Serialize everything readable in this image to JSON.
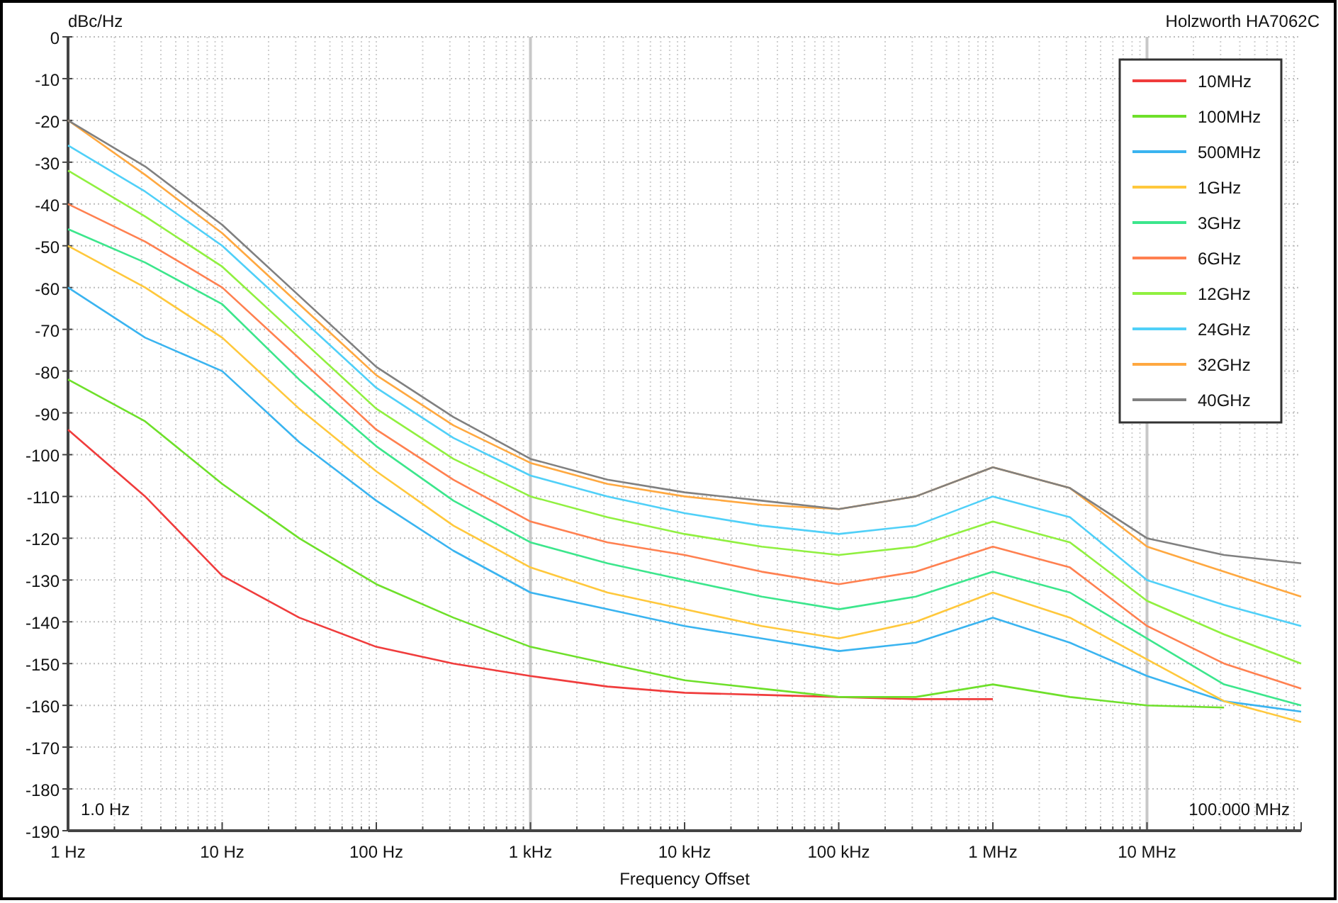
{
  "chart_data": {
    "type": "line",
    "title": "Holzworth HA7062C",
    "xlabel": "Frequency Offset",
    "ylabel": "dBc/Hz",
    "categories": [
      "1 Hz",
      null,
      "10 Hz",
      null,
      "100 Hz",
      null,
      "1 kHz",
      null,
      "10 kHz",
      null,
      "100 kHz",
      null,
      "1 MHz",
      null,
      "10 MHz",
      null,
      null
    ],
    "ylim": [
      -190,
      0
    ],
    "grid": true,
    "legend": true,
    "yticks": [
      0,
      -10,
      -20,
      -30,
      -40,
      -50,
      -60,
      -70,
      -80,
      -90,
      -100,
      -110,
      -120,
      -130,
      -140,
      -150,
      -160,
      -170,
      -180,
      -190
    ],
    "series": [
      {
        "name": "10MHz",
        "color": "#f03c3c",
        "values": [
          -94,
          -110,
          -129,
          -139,
          -146,
          -150,
          -153,
          -155.5,
          -157,
          -157.5,
          -158,
          -158.5,
          -158.5,
          null,
          null,
          null,
          null
        ]
      },
      {
        "name": "100MHz",
        "color": "#6ee02a",
        "values": [
          -82,
          -92,
          -107,
          -120,
          -131,
          -139,
          -146,
          -150,
          -154,
          -156,
          -158,
          -158,
          -155,
          -158,
          -160,
          -160.5,
          null
        ]
      },
      {
        "name": "500MHz",
        "color": "#3ab4f0",
        "values": [
          -60,
          -72,
          -80,
          -97,
          -111,
          -123,
          -133,
          -137,
          -141,
          -144,
          -147,
          -145,
          -139,
          -145,
          -153,
          -159,
          -161.5
        ]
      },
      {
        "name": "1GHz",
        "color": "#ffc83c",
        "values": [
          -50,
          -60,
          -72,
          -89,
          -104,
          -117,
          -127,
          -133,
          -137,
          -141,
          -144,
          -140,
          -133,
          -139,
          -149,
          -159,
          -164
        ]
      },
      {
        "name": "3GHz",
        "color": "#3ce68c",
        "values": [
          -46,
          -54,
          -64,
          -82,
          -98,
          -111,
          -121,
          -126,
          -130,
          -134,
          -137,
          -134,
          -128,
          -133,
          -144,
          -155,
          -160
        ]
      },
      {
        "name": "6GHz",
        "color": "#ff8050",
        "values": [
          -40,
          -49,
          -60,
          -77,
          -94,
          -106,
          -116,
          -121,
          -124,
          -128,
          -131,
          -128,
          -122,
          -127,
          -141,
          -150,
          -156
        ]
      },
      {
        "name": "12GHz",
        "color": "#90f040",
        "values": [
          -32,
          -43,
          -55,
          -72,
          -89,
          -101,
          -110,
          -115,
          -119,
          -122,
          -124,
          -122,
          -116,
          -121,
          -135,
          -143,
          -150
        ]
      },
      {
        "name": "24GHz",
        "color": "#50d0f8",
        "values": [
          -26,
          -37,
          -50,
          -67,
          -84,
          -96,
          -105,
          -110,
          -114,
          -117,
          -119,
          -117,
          -110,
          -115,
          -130,
          -136,
          -141
        ]
      },
      {
        "name": "32GHz",
        "color": "#ffa840",
        "values": [
          -20,
          -33,
          -47,
          -64,
          -81,
          -93,
          -102,
          -107,
          -110,
          -112,
          -113,
          -110,
          -103,
          -108,
          -122,
          -128,
          -134
        ]
      },
      {
        "name": "40GHz",
        "color": "#808080",
        "values": [
          -20,
          -31,
          -45,
          -62,
          -79,
          -91,
          -101,
          -106,
          -109,
          -111,
          -113,
          -110,
          -103,
          -108,
          -120,
          -124,
          -126
        ]
      }
    ],
    "annotations": [
      {
        "text": "1.0 Hz"
      },
      {
        "text": "100.000 MHz"
      }
    ]
  }
}
